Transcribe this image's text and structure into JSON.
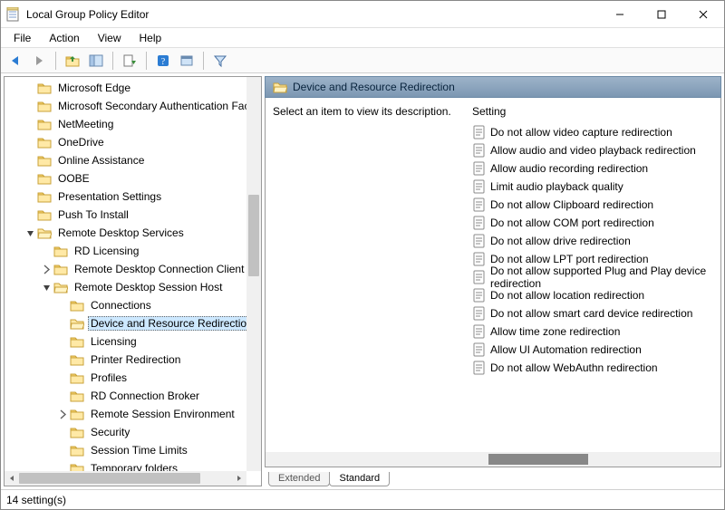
{
  "window": {
    "title": "Local Group Policy Editor"
  },
  "menu": {
    "file": "File",
    "action": "Action",
    "view": "View",
    "help": "Help"
  },
  "tree": {
    "items": [
      {
        "indent": 1,
        "chev": "none",
        "label": "Microsoft Edge"
      },
      {
        "indent": 1,
        "chev": "none",
        "label": "Microsoft Secondary Authentication Factor"
      },
      {
        "indent": 1,
        "chev": "none",
        "label": "NetMeeting"
      },
      {
        "indent": 1,
        "chev": "none",
        "label": "OneDrive"
      },
      {
        "indent": 1,
        "chev": "none",
        "label": "Online Assistance"
      },
      {
        "indent": 1,
        "chev": "none",
        "label": "OOBE"
      },
      {
        "indent": 1,
        "chev": "none",
        "label": "Presentation Settings"
      },
      {
        "indent": 1,
        "chev": "none",
        "label": "Push To Install"
      },
      {
        "indent": 1,
        "chev": "down",
        "label": "Remote Desktop Services"
      },
      {
        "indent": 2,
        "chev": "none",
        "label": "RD Licensing"
      },
      {
        "indent": 2,
        "chev": "right",
        "label": "Remote Desktop Connection Client"
      },
      {
        "indent": 2,
        "chev": "down",
        "label": "Remote Desktop Session Host"
      },
      {
        "indent": 3,
        "chev": "none",
        "label": "Connections"
      },
      {
        "indent": 3,
        "chev": "none",
        "label": "Device and Resource Redirection",
        "selected": true
      },
      {
        "indent": 3,
        "chev": "none",
        "label": "Licensing"
      },
      {
        "indent": 3,
        "chev": "none",
        "label": "Printer Redirection"
      },
      {
        "indent": 3,
        "chev": "none",
        "label": "Profiles"
      },
      {
        "indent": 3,
        "chev": "none",
        "label": "RD Connection Broker"
      },
      {
        "indent": 3,
        "chev": "right",
        "label": "Remote Session Environment"
      },
      {
        "indent": 3,
        "chev": "none",
        "label": "Security"
      },
      {
        "indent": 3,
        "chev": "none",
        "label": "Session Time Limits"
      },
      {
        "indent": 3,
        "chev": "none",
        "label": "Temporary folders"
      }
    ]
  },
  "right": {
    "header": "Device and Resource Redirection",
    "description_prompt": "Select an item to view its description.",
    "column_header": "Setting",
    "settings": [
      "Do not allow video capture redirection",
      "Allow audio and video playback redirection",
      "Allow audio recording redirection",
      "Limit audio playback quality",
      "Do not allow Clipboard redirection",
      "Do not allow COM port redirection",
      "Do not allow drive redirection",
      "Do not allow LPT port redirection",
      "Do not allow supported Plug and Play device redirection",
      "Do not allow location redirection",
      "Do not allow smart card device redirection",
      "Allow time zone redirection",
      "Allow UI Automation redirection",
      "Do not allow WebAuthn redirection"
    ]
  },
  "tabs": {
    "extended": "Extended",
    "standard": "Standard"
  },
  "status": {
    "text": "14 setting(s)"
  }
}
